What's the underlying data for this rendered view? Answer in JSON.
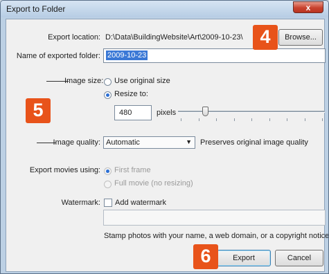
{
  "window": {
    "title": "Export to Folder",
    "close_glyph": "x"
  },
  "export_location": {
    "label": "Export location:",
    "value": "D:\\Data\\BuildingWebsite\\Art\\2009-10-23\\",
    "browse_label": "Browse..."
  },
  "folder_name": {
    "label": "Name of exported folder:",
    "value": "2009-10-23"
  },
  "image_size": {
    "label": "Image size:",
    "options": [
      {
        "label": "Use original size",
        "selected": false
      },
      {
        "label": "Resize to:",
        "selected": true
      }
    ],
    "value": "480",
    "unit": "pixels",
    "slider_level": 0.17
  },
  "image_quality": {
    "label": "Image quality:",
    "selected": "Automatic",
    "note": "Preserves original image quality"
  },
  "export_movies": {
    "label": "Export movies using:",
    "options": [
      {
        "label": "First frame",
        "selected": true,
        "disabled": true
      },
      {
        "label": "Full movie (no resizing)",
        "selected": false,
        "disabled": true
      }
    ]
  },
  "watermark": {
    "label": "Watermark:",
    "checkbox_label": "Add watermark",
    "checked": false,
    "value": "",
    "hint": "Stamp photos with your name, a web domain, or a copyright notice."
  },
  "footer": {
    "export_label": "Export",
    "cancel_label": "Cancel"
  },
  "callouts": [
    "4",
    "5",
    "6"
  ],
  "colors": {
    "callout": "#e8531a",
    "selection": "#3a78d6"
  }
}
